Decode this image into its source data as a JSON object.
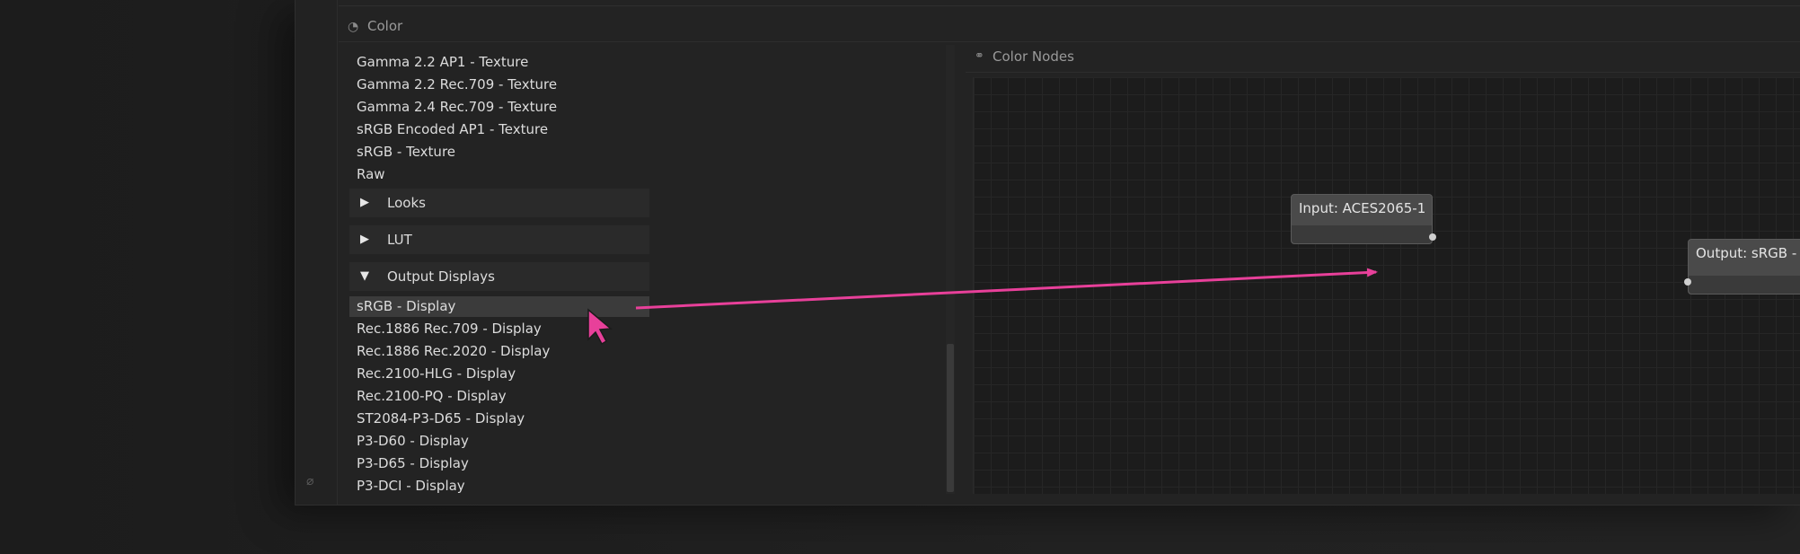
{
  "panel": {
    "title": "Color",
    "icon": "palette-icon"
  },
  "color_spaces_top": [
    "Gamma 2.2 AP1 - Texture",
    "Gamma 2.2 Rec.709 - Texture",
    "Gamma 2.4 Rec.709 - Texture",
    "sRGB Encoded AP1 - Texture",
    "sRGB - Texture",
    "Raw"
  ],
  "sections": {
    "looks": "Looks",
    "lut": "LUT",
    "output_displays": "Output Displays"
  },
  "output_displays": [
    "sRGB - Display",
    "Rec.1886 Rec.709 - Display",
    "Rec.1886 Rec.2020 - Display",
    "Rec.2100-HLG - Display",
    "Rec.2100-PQ - Display",
    "ST2084-P3-D65 - Display",
    "P3-D60 - Display",
    "P3-D65 - Display",
    "P3-DCI - Display"
  ],
  "selected_output": "sRGB - Display",
  "graph": {
    "title": "Color Nodes",
    "icon": "node-graph-icon",
    "nodes": {
      "input": "Input: ACES2065-1",
      "output": "Output: sRGB - Display"
    }
  },
  "accent_color": "#e8409a"
}
